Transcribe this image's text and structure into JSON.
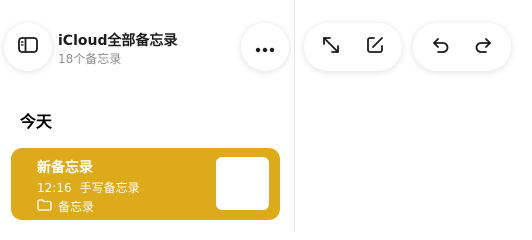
{
  "header": {
    "title": "iCloud全部备忘录",
    "subtitle": "18个备忘录"
  },
  "icons": {
    "sidebar": "sidebar-icon",
    "more": "ellipsis-icon",
    "expand": "expand-arrows-icon",
    "compose": "compose-icon",
    "undo": "undo-icon",
    "redo": "redo-icon",
    "folder": "folder-icon"
  },
  "list": {
    "section_title": "今天",
    "notes": [
      {
        "title": "新备忘录",
        "time": "12:16",
        "preview": "手写备忘录",
        "folder": "备忘录",
        "selected": true
      }
    ]
  },
  "colors": {
    "accent": "#dcaa1a",
    "text_primary": "#1c1c1e",
    "text_secondary": "#8e8e93"
  }
}
